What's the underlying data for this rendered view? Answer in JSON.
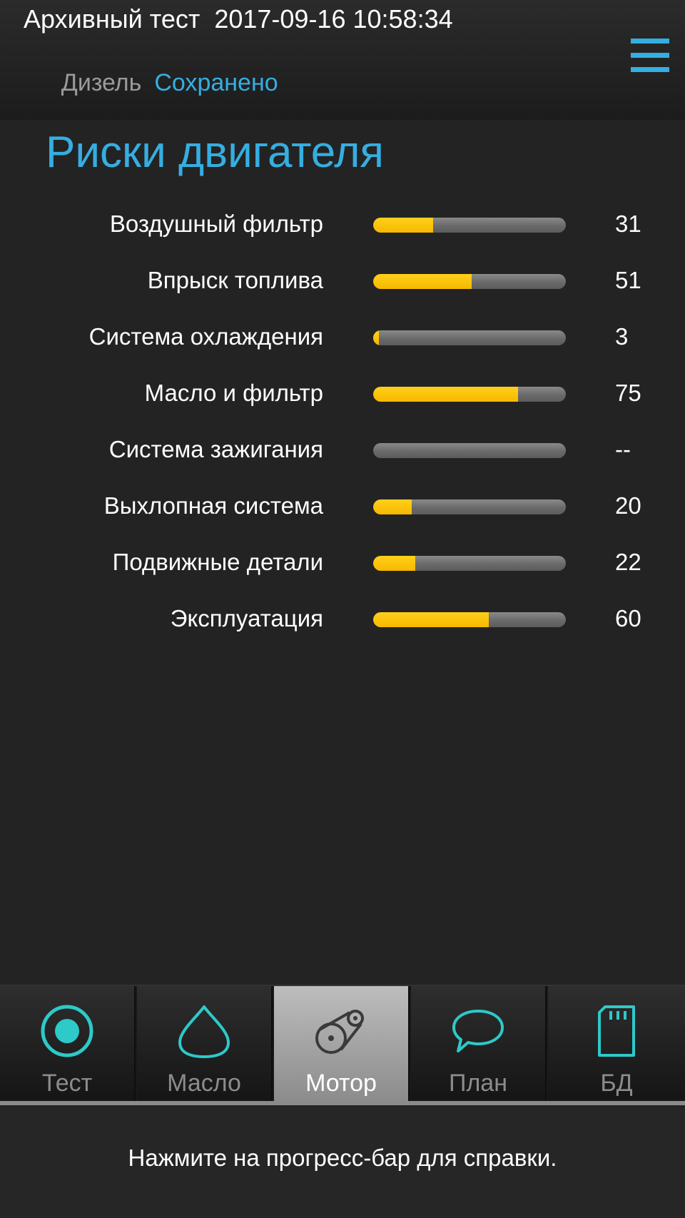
{
  "header": {
    "title": "Архивный тест  2017-09-16 10:58:34",
    "fuel_type": "Дизель",
    "status": "Сохранено",
    "menu_icon": "hamburger-menu-icon"
  },
  "main": {
    "title": "Риски двигателя",
    "risks": [
      {
        "label": "Воздушный фильтр",
        "value_text": "31",
        "level": 0.31
      },
      {
        "label": "Впрыск топлива",
        "value_text": "51",
        "level": 0.51
      },
      {
        "label": "Система охлаждения",
        "value_text": "3",
        "level": 0.03
      },
      {
        "label": "Масло и фильтр",
        "value_text": "75",
        "level": 0.75
      },
      {
        "label": "Система зажигания",
        "value_text": "--",
        "level": 0
      },
      {
        "label": "Выхлопная система",
        "value_text": "20",
        "level": 0.2
      },
      {
        "label": "Подвижные детали",
        "value_text": "22",
        "level": 0.22
      },
      {
        "label": "Эксплуатация",
        "value_text": "60",
        "level": 0.6
      }
    ]
  },
  "tabs": [
    {
      "label": "Тест",
      "icon": "record-icon",
      "active": false
    },
    {
      "label": "Масло",
      "icon": "oil-drop-icon",
      "active": false
    },
    {
      "label": "Мотор",
      "icon": "engine-belt-icon",
      "active": true
    },
    {
      "label": "План",
      "icon": "speech-bubble-icon",
      "active": false
    },
    {
      "label": "БД",
      "icon": "sd-card-icon",
      "active": false
    }
  ],
  "footer": {
    "hint": "Нажмите на прогресс-бар для справки."
  },
  "colors": {
    "accent": "#35aee1",
    "bar_fill": "#ffc400",
    "bar_track": "#6f6f6f",
    "icon_teal": "#2ec9c9"
  }
}
